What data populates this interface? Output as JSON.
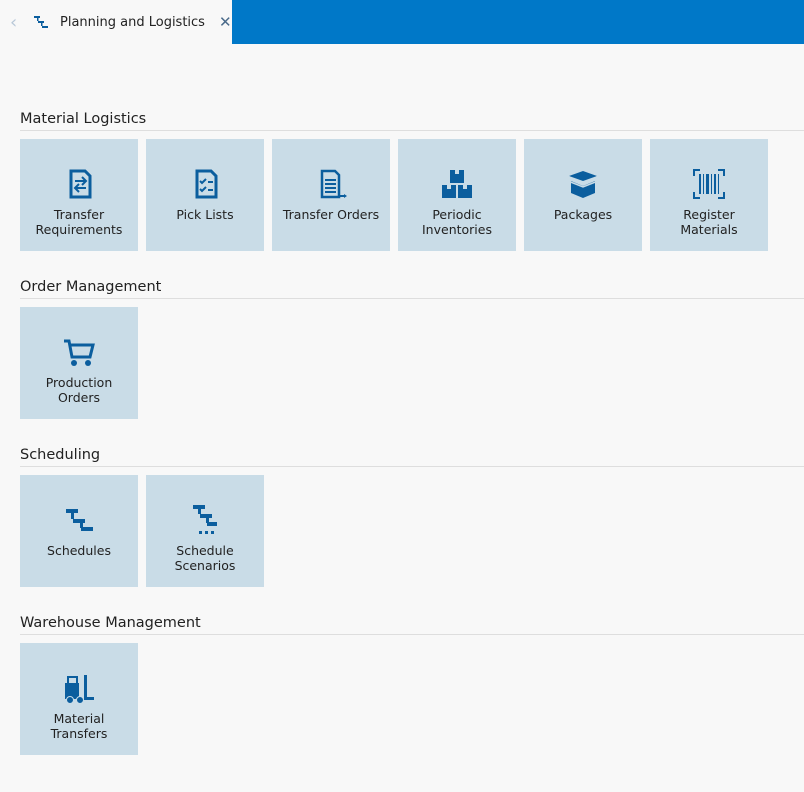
{
  "tab": {
    "title": "Planning and Logistics",
    "back_icon": "chevron-left-icon",
    "icon": "schedule-icon",
    "close_icon": "close-icon"
  },
  "colors": {
    "header": "#0078c8",
    "tile": "#c9dce7",
    "icon": "#0b5e9e"
  },
  "sections": [
    {
      "title": "Material Logistics",
      "tiles": [
        {
          "label": "Transfer Requirements",
          "icon": "transfer-document-icon"
        },
        {
          "label": "Pick Lists",
          "icon": "checklist-icon"
        },
        {
          "label": "Transfer Orders",
          "icon": "document-arrow-icon"
        },
        {
          "label": "Periodic Inventories",
          "icon": "boxes-icon"
        },
        {
          "label": "Packages",
          "icon": "open-box-icon"
        },
        {
          "label": "Register Materials",
          "icon": "barcode-icon"
        }
      ]
    },
    {
      "title": "Order Management",
      "tiles": [
        {
          "label": "Production Orders",
          "icon": "cart-icon"
        }
      ]
    },
    {
      "title": "Scheduling",
      "tiles": [
        {
          "label": "Schedules",
          "icon": "schedule-icon"
        },
        {
          "label": "Schedule Scenarios",
          "icon": "schedule-scenario-icon"
        }
      ]
    },
    {
      "title": "Warehouse Management",
      "tiles": [
        {
          "label": "Material Transfers",
          "icon": "forklift-icon"
        }
      ]
    }
  ]
}
